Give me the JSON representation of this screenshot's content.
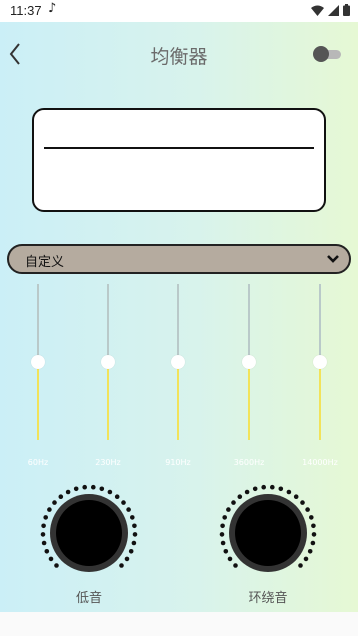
{
  "status_bar": {
    "time": "11:37",
    "icons": [
      "music-note-icon",
      "wifi-icon",
      "signal-icon",
      "battery-icon"
    ]
  },
  "header": {
    "title": "均衡器",
    "back_icon": "chevron-left-icon",
    "toggle_state": "off"
  },
  "preset": {
    "label": "自定义",
    "icon": "chevron-down-icon"
  },
  "equalizer": {
    "bands": [
      {
        "label": "60Hz",
        "level": 0.5
      },
      {
        "label": "230Hz",
        "level": 0.5
      },
      {
        "label": "910Hz",
        "level": 0.5
      },
      {
        "label": "3600Hz",
        "level": 0.5
      },
      {
        "label": "14000Hz",
        "level": 0.5
      }
    ]
  },
  "knobs": [
    {
      "label": "低音"
    },
    {
      "label": "环绕音"
    }
  ],
  "colors": {
    "accent_yellow": "#f2e35a",
    "preset_bg": "#b5ab9f",
    "gradient_start": "#cbeff7",
    "gradient_end": "#e6f8d4"
  }
}
